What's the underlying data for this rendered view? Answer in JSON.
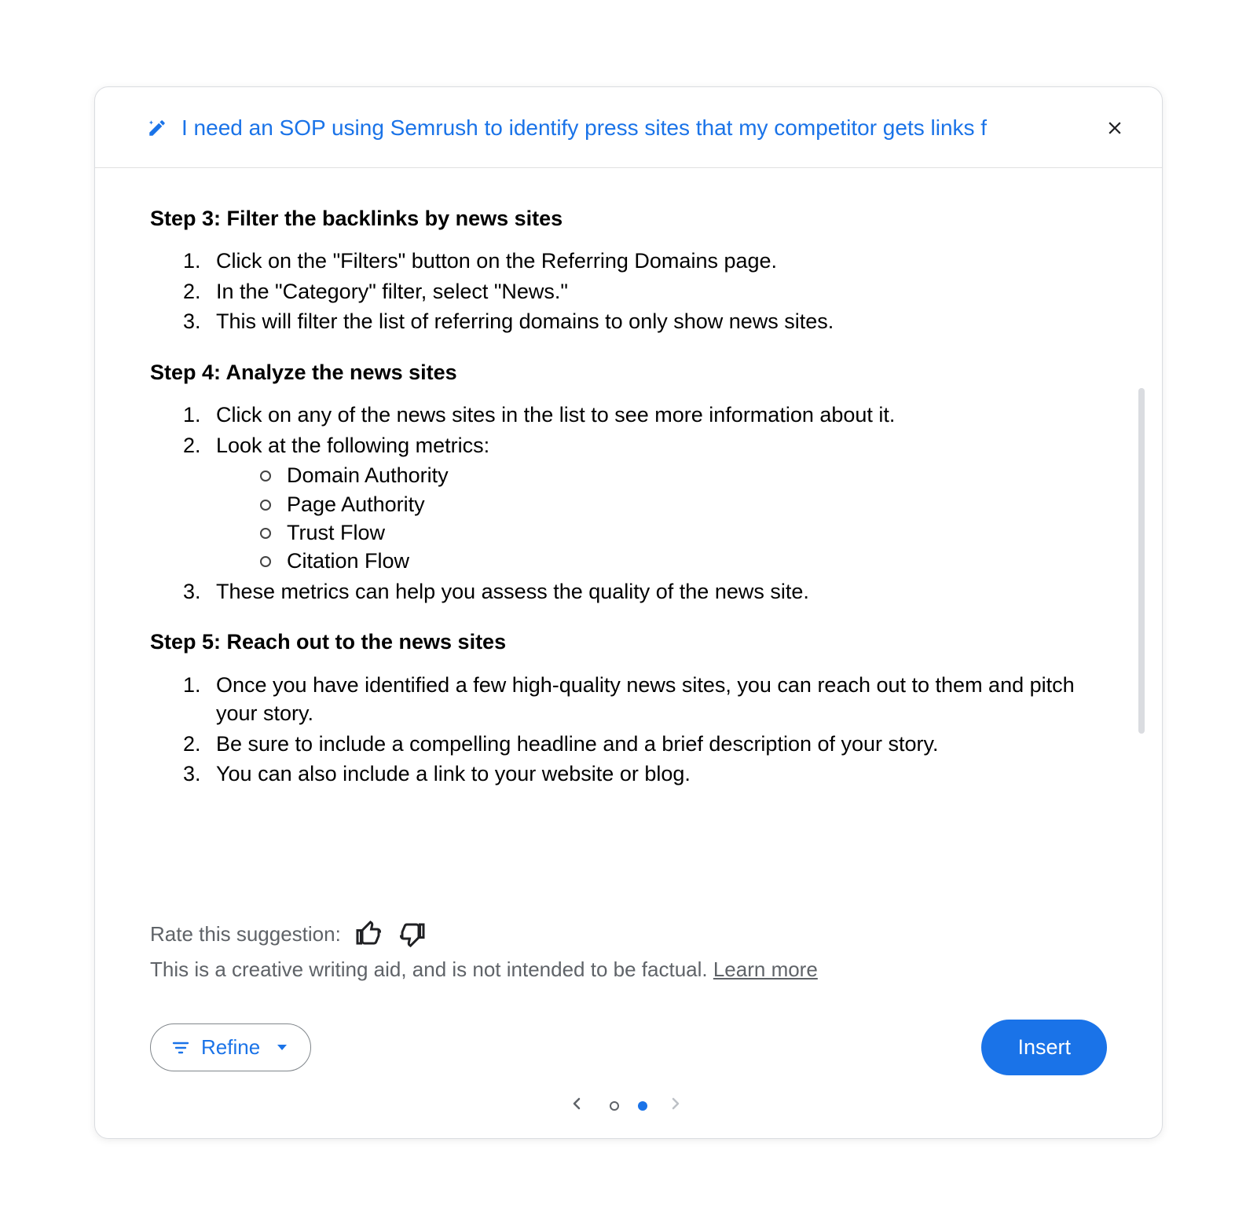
{
  "header": {
    "prompt": "I need an SOP using Semrush to identify press sites that my competitor gets links f"
  },
  "content": {
    "step3": {
      "title": "Step 3: Filter the backlinks by news sites",
      "items": [
        "Click on the \"Filters\" button on the Referring Domains page.",
        "In the \"Category\" filter, select \"News.\"",
        "This will filter the list of referring domains to only show news sites."
      ]
    },
    "step4": {
      "title": "Step 4: Analyze the news sites",
      "items": [
        "Click on any of the news sites in the list to see more information about it.",
        "Look at the following metrics:",
        "These metrics can help you assess the quality of the news site."
      ],
      "metrics": [
        "Domain Authority",
        "Page Authority",
        "Trust Flow",
        "Citation Flow"
      ]
    },
    "step5": {
      "title": "Step 5: Reach out to the news sites",
      "items": [
        "Once you have identified a few high-quality news sites, you can reach out to them and pitch your story.",
        "Be sure to include a compelling headline and a brief description of your story.",
        "You can also include a link to your website or blog."
      ]
    }
  },
  "footer": {
    "rate_label": "Rate this suggestion:",
    "disclaimer_text": "This is a creative writing aid, and is not intended to be factual. ",
    "learn_more": "Learn more",
    "refine_label": "Refine",
    "insert_label": "Insert"
  }
}
